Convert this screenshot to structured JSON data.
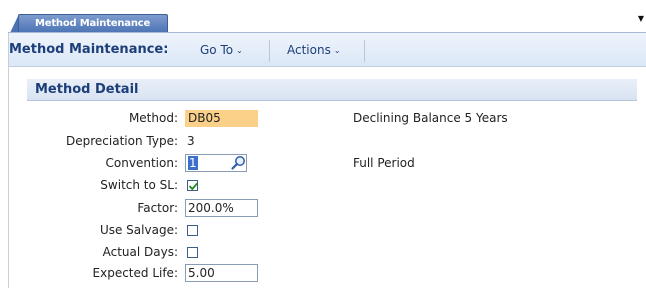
{
  "tab": {
    "label": "Method Maintenance"
  },
  "toolbar": {
    "title": "Method Maintenance:",
    "goto_label": "Go To",
    "actions_label": "Actions"
  },
  "section": {
    "title": "Method Detail"
  },
  "form": {
    "method": {
      "label": "Method:",
      "value": "DB05",
      "description": "Declining Balance 5 Years"
    },
    "depreciation_type": {
      "label": "Depreciation Type:",
      "value": "3"
    },
    "convention": {
      "label": "Convention:",
      "value": "1",
      "description": "Full Period"
    },
    "switch_to_sl": {
      "label": "Switch to SL:",
      "checked": true
    },
    "factor": {
      "label": "Factor:",
      "value": "200.0%"
    },
    "use_salvage": {
      "label": "Use Salvage:",
      "checked": false
    },
    "actual_days": {
      "label": "Actual Days:",
      "checked": false
    },
    "expected_life": {
      "label": "Expected Life:",
      "value": "5.00"
    }
  },
  "colors": {
    "accent": "#1d3f79",
    "tab_bg": "#4b73b4",
    "required_field": "#fbd18a"
  }
}
